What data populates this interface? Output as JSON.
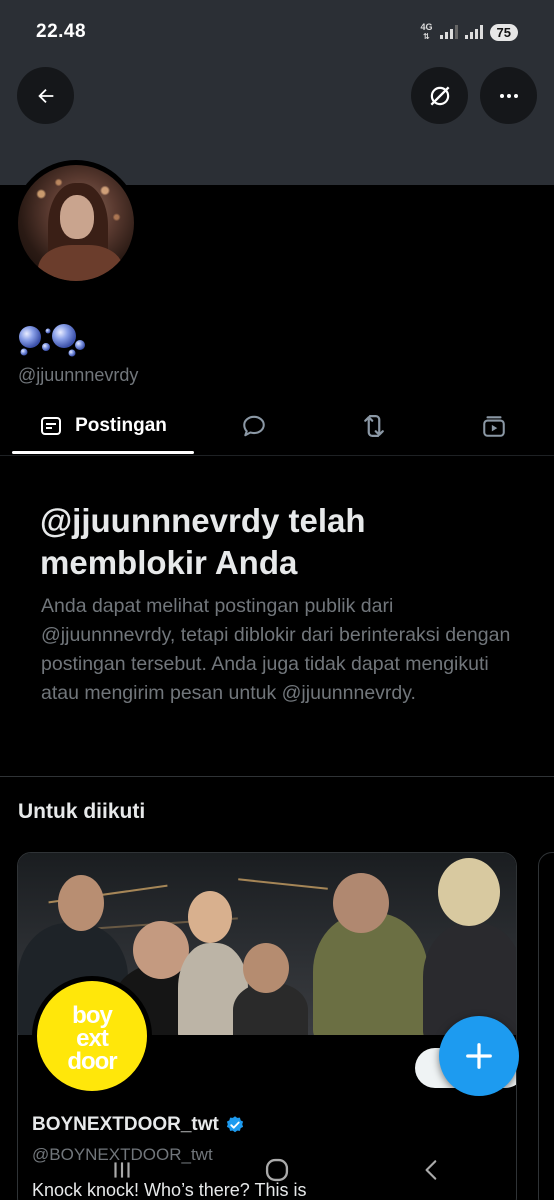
{
  "status_bar": {
    "time": "22.48",
    "network": "4G",
    "battery": "75"
  },
  "header": {
    "icons": [
      "back-arrow-icon",
      "grok-icon",
      "more-icon"
    ]
  },
  "profile": {
    "display_name_icon": "bubbles-emoji",
    "handle": "@jjuunnnevrdy"
  },
  "tabs": [
    {
      "label": "Postingan",
      "icon": "posts-icon",
      "active": true
    },
    {
      "label": "",
      "icon": "reply-icon",
      "active": false
    },
    {
      "label": "",
      "icon": "repost-icon",
      "active": false
    },
    {
      "label": "",
      "icon": "media-icon",
      "active": false
    }
  ],
  "block_notice": {
    "title": "@jjuunnnevrdy telah memblokir Anda",
    "description": "Anda dapat melihat postingan publik dari @jjuunnnevrdy, tetapi diblokir dari berinteraksi dengan postingan tersebut. Anda juga tidak dapat mengikuti atau mengirim pesan untuk @jjuunnnevrdy."
  },
  "suggestions": {
    "title": "Untuk diikuti",
    "cards": [
      {
        "name": "BOYNEXTDOOR_twt",
        "verified": true,
        "handle": "@BOYNEXTDOOR_twt",
        "bio": "Knock knock! Who’s there? This is",
        "avatar_text": "boy next door"
      }
    ]
  },
  "colors": {
    "background": "#000000",
    "accent": "#1d9bf0",
    "secondary_text": "#71767b",
    "banner": "#2b2f35",
    "card_avatar": "#ffe70a"
  }
}
